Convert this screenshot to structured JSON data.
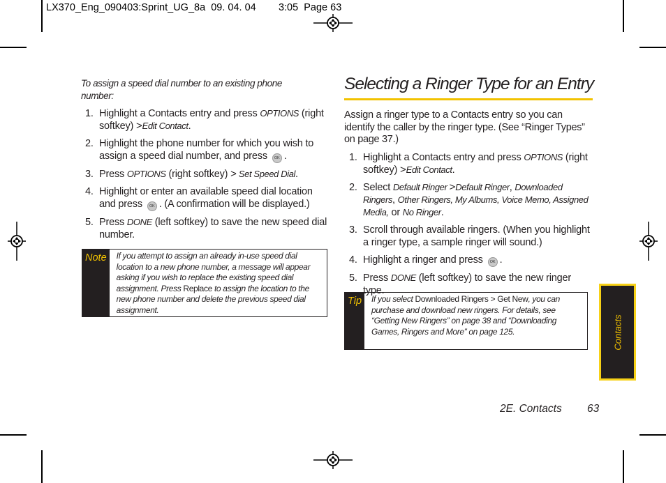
{
  "slug": {
    "filename": "LX370_Eng_090403:Sprint_UG_8a",
    "date": "09. 04. 04",
    "time_page": "3:05  Page 63"
  },
  "left_column": {
    "intro": "To assign a speed dial number to an existing phone number:",
    "steps": [
      {
        "num": "1.",
        "parts": [
          "Highlight a Contacts entry and press ",
          "OPTIONS",
          " (right softkey) ",
          ">",
          "Edit Contact",
          "."
        ]
      },
      {
        "num": "2.",
        "parts": [
          "Highlight the phone number for which you wish to assign a speed dial number, and press ",
          "."
        ]
      },
      {
        "num": "3.",
        "parts": [
          "Press ",
          "OPTIONS",
          " (right softkey) ",
          ">",
          " Set Speed Dial",
          "."
        ]
      },
      {
        "num": "4.",
        "parts": [
          "Highlight or enter an available speed dial location and press ",
          ". (A confirmation will be displayed.)"
        ]
      },
      {
        "num": "5.",
        "parts": [
          "Press ",
          "DONE",
          " (left softkey) to save the new speed dial number."
        ]
      }
    ],
    "note": {
      "label": "Note",
      "text_before": "If you attempt to assign an already in-use speed dial location to a new phone number, a message will appear asking if you wish to replace the existing speed dial assignment. Press ",
      "button": "Replace",
      "text_after": " to assign the location to the new phone number and delete the previous speed dial assignment."
    }
  },
  "right_column": {
    "title": "Selecting a Ringer Type for an Entry",
    "intro": "Assign a ringer type to a Contacts entry so you can identify the caller by the ringer type. (See “Ringer Types” on page 37.)",
    "steps": [
      {
        "num": "1.",
        "parts": [
          "Highlight a Contacts entry and press ",
          "OPTIONS",
          " (right softkey) ",
          ">",
          "Edit Contact",
          "."
        ]
      },
      {
        "num": "2.",
        "parts": [
          "Select ",
          "Default Ringer ",
          ">",
          "Default Ringer",
          ", ",
          "Downloaded Ringers",
          ", ",
          "Other Ringers, My Albums, Voice Memo, Assigned Media,",
          " or ",
          "No Ringer",
          "."
        ]
      },
      {
        "num": "3.",
        "parts": [
          "Scroll through available ringers. (When you highlight a ringer type, a sample ringer will sound.)"
        ]
      },
      {
        "num": "4.",
        "parts": [
          "Highlight a ringer and press ",
          "."
        ]
      },
      {
        "num": "5.",
        "parts": [
          "Press ",
          "DONE",
          " (left softkey) to save the new ringer type."
        ]
      }
    ],
    "tip": {
      "label": "Tip",
      "text_before": "If you select ",
      "menu_path": "Downloaded Ringers > Get New",
      "text_after": ", you can purchase and download new ringers. For details, see “Getting New Ringers” on page 38 and “Downloading Games, Ringers and More” on page 125."
    }
  },
  "ok_key_label": "OK",
  "thumb_tab": "Contacts",
  "footer": {
    "section": "2E. Contacts",
    "page": "63"
  },
  "colors": {
    "accent": "#f2c200",
    "box_dark": "#231f20",
    "text": "#231f20"
  }
}
